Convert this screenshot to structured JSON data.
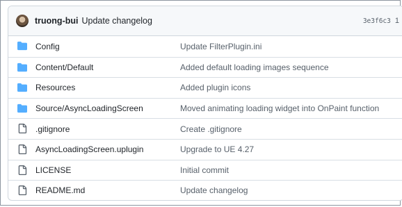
{
  "header": {
    "author": "truong-bui",
    "message": "Update changelog",
    "hash": "3e3f6c3",
    "hash_suffix": "1"
  },
  "files": [
    {
      "type": "folder",
      "name": "Config",
      "commit": "Update FilterPlugin.ini"
    },
    {
      "type": "folder",
      "name": "Content/Default",
      "commit": "Added default loading images sequence"
    },
    {
      "type": "folder",
      "name": "Resources",
      "commit": "Added plugin icons"
    },
    {
      "type": "folder",
      "name": "Source/AsyncLoadingScreen",
      "commit": "Moved animating loading widget into OnPaint function"
    },
    {
      "type": "file",
      "name": ".gitignore",
      "commit": "Create .gitignore"
    },
    {
      "type": "file",
      "name": "AsyncLoadingScreen.uplugin",
      "commit": "Upgrade to UE 4.27"
    },
    {
      "type": "file",
      "name": "LICENSE",
      "commit": "Initial commit"
    },
    {
      "type": "file",
      "name": "README.md",
      "commit": "Update changelog"
    }
  ],
  "colors": {
    "folder_icon": "#54aeff",
    "file_icon": "#57606a"
  },
  "icons": {
    "folder": "folder-icon",
    "file": "file-icon"
  }
}
